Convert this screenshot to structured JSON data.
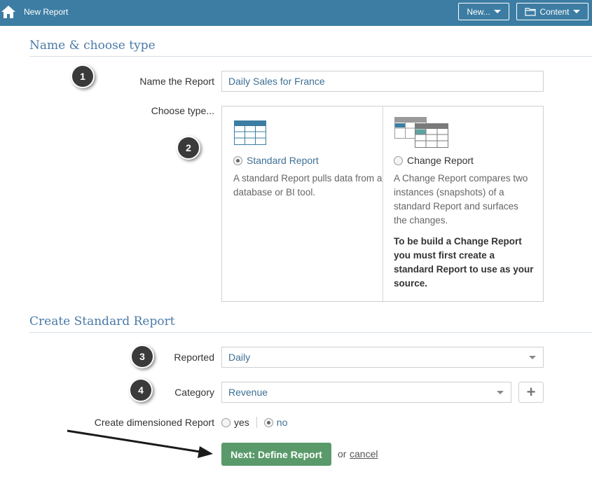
{
  "topbar": {
    "title": "New Report",
    "new_button": "New...",
    "content_button": "Content",
    "home_icon": "home-icon",
    "folder_icon": "folder-icon",
    "bg_color": "#3d7da3"
  },
  "section1": {
    "title": "Name & choose type",
    "name_label": "Name the Report",
    "name_value": "Daily Sales for France",
    "type_label": "Choose type..."
  },
  "types": {
    "standard": {
      "label": "Standard Report",
      "selected": true,
      "description": "A standard Report pulls data from a database or BI tool."
    },
    "change": {
      "label": "Change Report",
      "selected": false,
      "description": "A Change Report compares two instances (snapshots) of a standard Report and surfaces the changes.",
      "note": "To be build a Change Report you must first create a standard Report to use as your source."
    }
  },
  "section2": {
    "title": "Create Standard Report",
    "reported_label": "Reported",
    "reported_value": "Daily",
    "category_label": "Category",
    "category_value": "Revenue",
    "add_icon": "+",
    "dimensioned_label": "Create dimensioned Report",
    "dimensioned_yes": "yes",
    "dimensioned_no": "no",
    "dimensioned_selected": "no"
  },
  "actions": {
    "next_label": "Next: Define Report",
    "or_text": "or",
    "cancel_label": "cancel",
    "next_color": "#5a9a6a"
  },
  "steps": [
    "1",
    "2",
    "3",
    "4"
  ]
}
